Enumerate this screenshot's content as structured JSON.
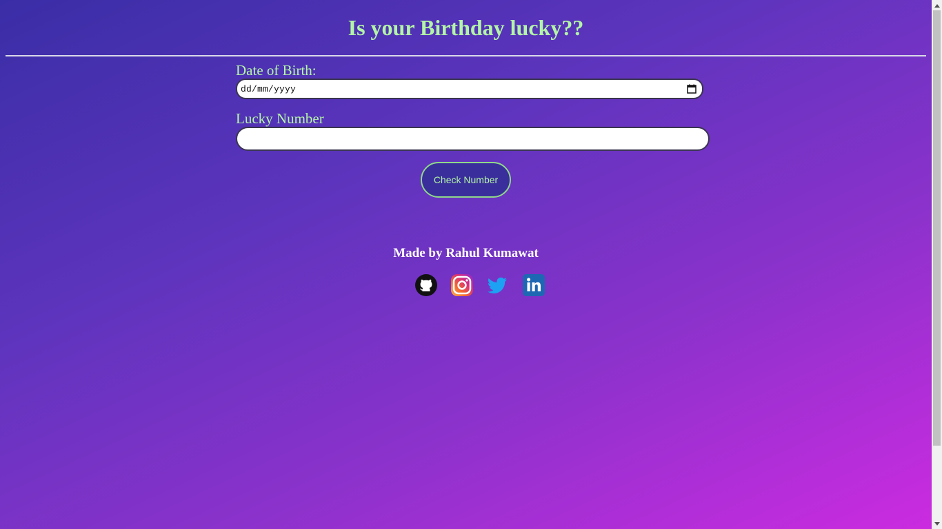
{
  "header": {
    "title": "Is your Birthday lucky??"
  },
  "form": {
    "dob_label": "Date of Birth:",
    "dob_placeholder": "dd/mm/yyyy",
    "lucky_label": "Lucky Number",
    "lucky_value": "",
    "check_button_label": "Check Number"
  },
  "footer": {
    "credit": "Made by Rahul Kumawat",
    "social_icons": [
      "github-icon",
      "instagram-icon",
      "twitter-icon",
      "linkedin-icon"
    ]
  },
  "colors": {
    "accent_text": "#b3f5a6",
    "button_bg": "#3a2e9c",
    "button_border": "#8fd98a",
    "gradient_start": "#3a2ea6",
    "gradient_end": "#cc2be0"
  }
}
